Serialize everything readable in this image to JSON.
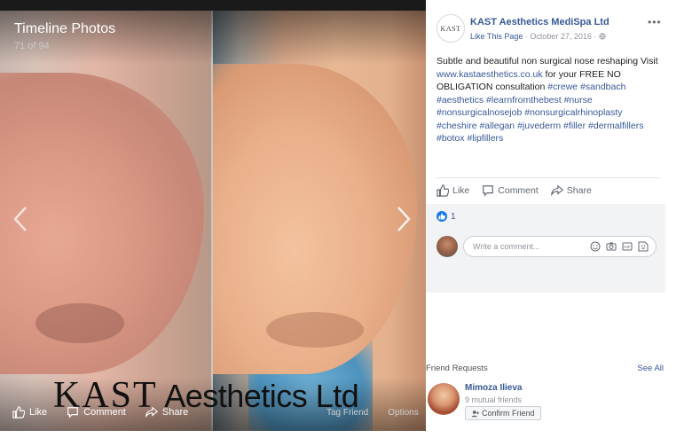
{
  "viewer": {
    "title": "Timeline Photos",
    "count": "71 of 94",
    "watermark_brand": "KAST",
    "watermark_rest": " Aesthetics Ltd",
    "actions": {
      "like": "Like",
      "comment": "Comment",
      "share": "Share"
    },
    "right_actions": {
      "tag": "Tag Friend",
      "options": "Options"
    }
  },
  "post": {
    "page_name": "KAST Aesthetics MediSpa Ltd",
    "avatar_text": "KAST",
    "like_page": "Like This Page",
    "date": " · October 27, 2016 · ",
    "text_intro": "Subtle and beautiful non surgical nose reshaping Visit ",
    "link": "www.kastaesthetics.co.uk",
    "text_mid": " for your FREE NO OBLIGATION consultation ",
    "hashtags": "#crewe #sandbach #aesthetics #learnfromthebest #nurse #nonsurgicalnosejob #nonsurgicalrhinoplasty #cheshire #allegan #juvederm #filler #dermalfillers #botox #lipfillers",
    "actions": {
      "like": "Like",
      "comment": "Comment",
      "share": "Share"
    },
    "like_count": "1",
    "comment_placeholder": "Write a comment..."
  },
  "friend_requests": {
    "header": "Friend Requests",
    "see_all": "See All",
    "items": [
      {
        "name": "Mimoza Ilieva",
        "mutual": "9 mutual friends",
        "confirm": "Confirm Friend"
      }
    ]
  },
  "colors": {
    "link": "#385898",
    "meta": "#90949c",
    "like_blue": "#1877f2"
  },
  "icons": [
    "thumbs-up-icon",
    "comment-icon",
    "share-icon",
    "chevron-left-icon",
    "chevron-right-icon",
    "globe-icon",
    "more-icon",
    "emoji-icon",
    "camera-icon",
    "gif-icon",
    "sticker-icon",
    "add-friend-icon"
  ]
}
